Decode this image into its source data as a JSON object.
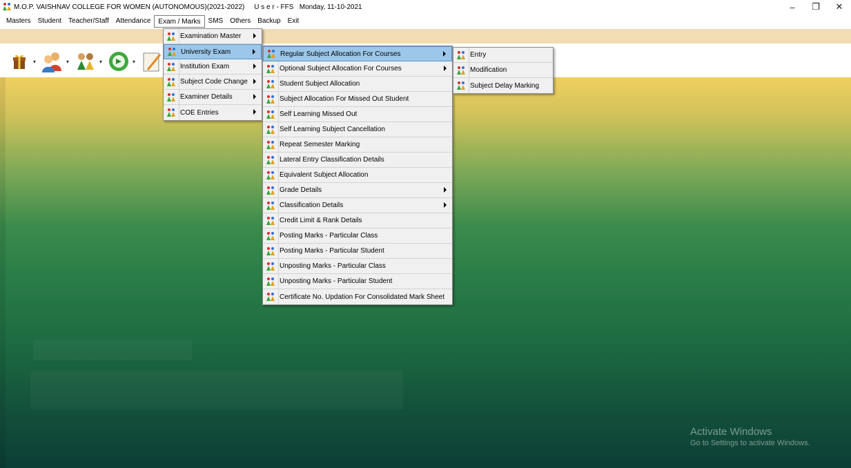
{
  "window": {
    "title": "M.O.P. VAISHNAV COLLEGE FOR WOMEN (AUTONOMOUS)(2021-2022)     U s e r - FFS   Monday, 11-10-2021",
    "minimize_label": "–",
    "restore_label": "❐",
    "close_label": "✕"
  },
  "menubar": {
    "items": [
      "Masters",
      "Student",
      "Teacher/Staff",
      "Attendance",
      "Exam / Marks",
      "SMS",
      "Others",
      "Backup",
      "Exit"
    ]
  },
  "exam_menu": {
    "items": [
      {
        "label": "Examination Master",
        "submenu": true
      },
      {
        "label": "University Exam",
        "submenu": true
      },
      {
        "label": "Institution Exam",
        "submenu": true
      },
      {
        "label": "Subject Code Change",
        "submenu": true
      },
      {
        "label": "Examiner Details",
        "submenu": true
      },
      {
        "label": "COE Entries",
        "submenu": true
      }
    ]
  },
  "university_menu": {
    "items": [
      {
        "label": "Regular Subject Allocation For Courses",
        "submenu": true
      },
      {
        "label": "Optional Subject Allocation For Courses",
        "submenu": true
      },
      {
        "label": "Student Subject Allocation",
        "submenu": false
      },
      {
        "label": "Subject Allocation For Missed Out Student",
        "submenu": false
      },
      {
        "label": "Self Learning Missed Out",
        "submenu": false
      },
      {
        "label": "Self Learning Subject Cancellation",
        "submenu": false
      },
      {
        "label": "Repeat Semester Marking",
        "submenu": false
      },
      {
        "label": "Lateral Entry Classification Details",
        "submenu": false
      },
      {
        "label": "Equivalent Subject Allocation",
        "submenu": false
      },
      {
        "label": "Grade Details",
        "submenu": true
      },
      {
        "label": "Classification Details",
        "submenu": true
      },
      {
        "label": "Credit Limit & Rank Details",
        "submenu": false
      },
      {
        "label": "Posting Marks - Particular Class",
        "submenu": false
      },
      {
        "label": "Posting Marks - Particular Student",
        "submenu": false
      },
      {
        "label": "Unposting Marks - Particular Class",
        "submenu": false
      },
      {
        "label": "Unposting Marks - Particular Student",
        "submenu": false
      },
      {
        "label": "Certificate No. Updation For Consolidated Mark Sheet",
        "submenu": false
      }
    ]
  },
  "regular_menu": {
    "items": [
      {
        "label": "Entry"
      },
      {
        "label": "Modification"
      },
      {
        "label": "Subject Delay Marking"
      }
    ]
  },
  "watermark": {
    "title": "Activate Windows",
    "subtitle": "Go to Settings to activate Windows."
  },
  "colors": {
    "menu_bg": "#f0f0f0",
    "highlight": "#9cc7ea",
    "tan_band": "#f1dcb3"
  }
}
